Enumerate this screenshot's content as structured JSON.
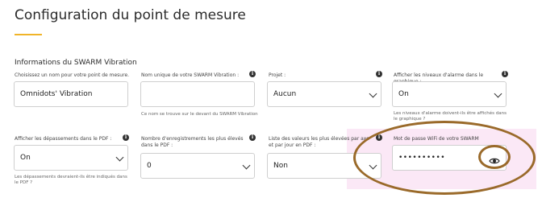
{
  "page": {
    "title": "Configuration du point de mesure",
    "section_title": "Informations du SWARM Vibration"
  },
  "fields": {
    "name": {
      "label": "Choisissez un nom pour votre point de mesure.",
      "value": "Omnidots' Vibration"
    },
    "unique_name": {
      "label": "Nom unique de votre SWARM Vibration :",
      "value": "",
      "help": "Ce nom se trouve sur le devant du SWARM Vibration"
    },
    "project": {
      "label": "Projet :",
      "value": "Aucun"
    },
    "alarm_levels_graph": {
      "label": "Afficher les niveaux d'alarme dans le graphique :",
      "value": "On",
      "help": "Les niveaux d'alarme doivent-ils être affichés dans le graphique ?"
    },
    "pdf_exceedances": {
      "label": "Afficher les dépassements dans le PDF :",
      "value": "On",
      "help": "Les dépassements devraient-ils être indiqués dans le PDF ?"
    },
    "highest_records_pdf": {
      "label": "Nombre d'enregistrements les plus élevés dans le PDF :",
      "value": "0"
    },
    "highest_values_list": {
      "label": "Liste des valeurs les plus élevées par axe et par jour en PDF :",
      "value": "Non"
    },
    "wifi_password": {
      "label": "Mot de passe WiFi de votre SWARM",
      "value": "••••••••••"
    }
  },
  "icons": {
    "info": "info-circle-icon",
    "dropdown": "chevron-down-icon",
    "eye": "eye-icon"
  },
  "colors": {
    "accent": "#f0b429",
    "annotation": "#9a6a2a",
    "highlight": "#f7d6ef"
  }
}
